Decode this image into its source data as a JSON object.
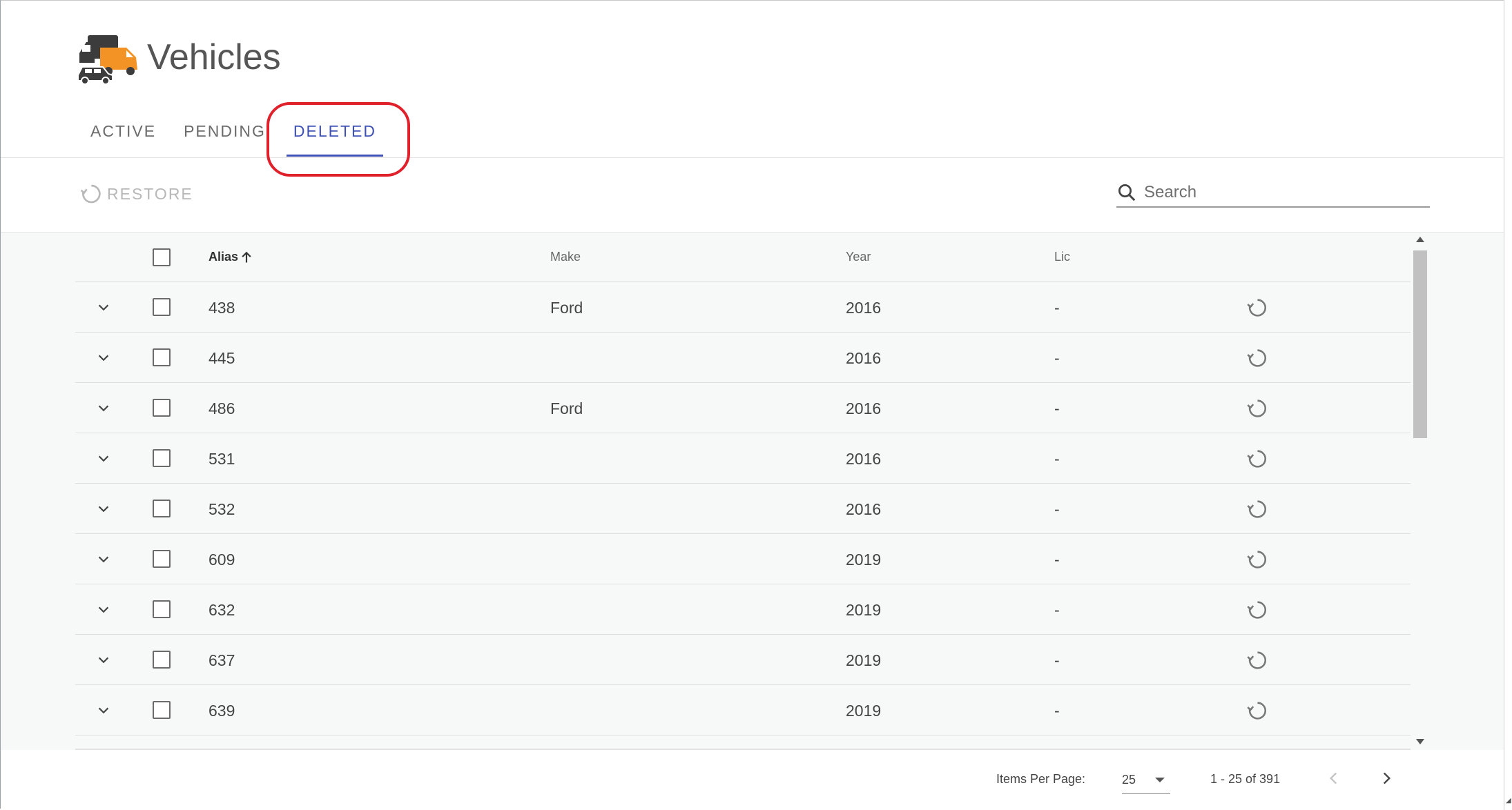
{
  "header": {
    "title": "Vehicles",
    "logo_icon": "vehicles-truck-car-icon"
  },
  "tabs": [
    {
      "label": "ACTIVE",
      "active": false
    },
    {
      "label": "PENDING",
      "active": false
    },
    {
      "label": "DELETED",
      "active": true
    }
  ],
  "toolbar": {
    "restore_label": "RESTORE",
    "restore_icon": "restore-icon",
    "search_placeholder": "Search",
    "search_icon": "search-icon"
  },
  "table": {
    "columns": {
      "alias": "Alias",
      "make": "Make",
      "year": "Year",
      "lic": "Lic"
    },
    "sort": {
      "column": "alias",
      "direction": "ascending",
      "icon": "arrow-up-icon"
    },
    "rows": [
      {
        "alias": "438",
        "make": "Ford",
        "year": "2016",
        "lic": "-"
      },
      {
        "alias": "445",
        "make": "",
        "year": "2016",
        "lic": "-"
      },
      {
        "alias": "486",
        "make": "Ford",
        "year": "2016",
        "lic": "-"
      },
      {
        "alias": "531",
        "make": "",
        "year": "2016",
        "lic": "-"
      },
      {
        "alias": "532",
        "make": "",
        "year": "2016",
        "lic": "-"
      },
      {
        "alias": "609",
        "make": "",
        "year": "2019",
        "lic": "-"
      },
      {
        "alias": "632",
        "make": "",
        "year": "2019",
        "lic": "-"
      },
      {
        "alias": "637",
        "make": "",
        "year": "2019",
        "lic": "-"
      },
      {
        "alias": "639",
        "make": "",
        "year": "2019",
        "lic": "-"
      }
    ]
  },
  "pagination": {
    "items_per_page_label": "Items Per Page:",
    "items_per_page": "25",
    "range": "1 - 25 of 391"
  },
  "colors": {
    "accent": "#3f51b5",
    "highlight": "#e0202a",
    "logo_orange": "#f39325",
    "logo_dark": "#3c3c3c"
  }
}
